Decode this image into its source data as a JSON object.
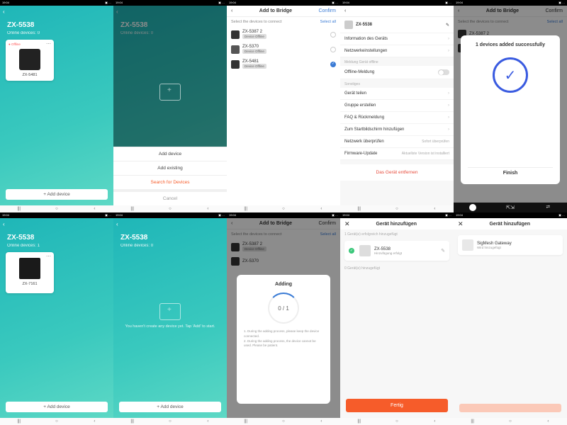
{
  "status": {
    "time": "19:04",
    "icons": "▣ …"
  },
  "nav": {
    "recents": "|||",
    "home": "○",
    "back": "‹"
  },
  "teal_home": {
    "title": "ZX-5538",
    "online": "Online devices: 0",
    "online1": "Online devices: 1",
    "add": "+  Add device",
    "card1": {
      "status": "● Offline",
      "name": "ZX-5481"
    },
    "card2": {
      "status": "",
      "name": "ZX-7161"
    },
    "empty": "You haven't create any device yet.\nTap 'Add' to start."
  },
  "sheet": {
    "add_device": "Add device",
    "add_existing": "Add existing",
    "search": "Search for Devices",
    "cancel": "Cancel"
  },
  "bridge": {
    "back": "‹",
    "title": "Add to Bridge",
    "confirm": "Confirm",
    "select_label": "Select the devices to connect",
    "select_all": "Select all",
    "d1": {
      "name": "ZX-5387 2",
      "off": "Device Offline"
    },
    "d2": {
      "name": "ZX-5370",
      "off": "Device Offline"
    },
    "d3": {
      "name": "ZX-5481",
      "off": "Device Offline"
    }
  },
  "settings": {
    "title": "ZX-5538",
    "edit": "✎",
    "info": "Information des Geräts",
    "net": "Netzwerkeinstellungen",
    "sec_offline": "Meldung Gerät offline",
    "offline_msg": "Offline-Meldung",
    "sec_other": "Sonstiges",
    "share": "Gerät teilen",
    "group": "Gruppe erstellen",
    "faq": "FAQ & Rückmeldung",
    "homescreen": "Zum Startbildschirm hinzufügen",
    "netcheck": "Netzwerk überprüfen",
    "netcheck_val": "Sofort überprüfen",
    "fw": "Firmware-Update",
    "fw_val": "Aktuellste Version ist installiert",
    "remove": "Das Gerät entfernen"
  },
  "success": {
    "msg": "1 devices added successfully",
    "check": "✓",
    "finish": "Finish"
  },
  "adding": {
    "title": "Adding",
    "progress": "0 / 1",
    "tip1": "1. During the adding process, please keep the device connected.",
    "tip2": "2. During the adding process, the device cannot be used. Please be patient."
  },
  "add_de": {
    "close": "✕",
    "title": "Gerät hinzufügen",
    "count1": "1 Gerät(e) erfolgreich hinzugefügt",
    "count0": "0 Gerät(e) hinzugefügt",
    "dev_name": "ZX-5538",
    "dev_sub": "Hinzufügung erfolgt",
    "gw_name": "SigMesh Gateway",
    "gw_sub": "Wird hinzugefügt",
    "done": "Fertig"
  }
}
